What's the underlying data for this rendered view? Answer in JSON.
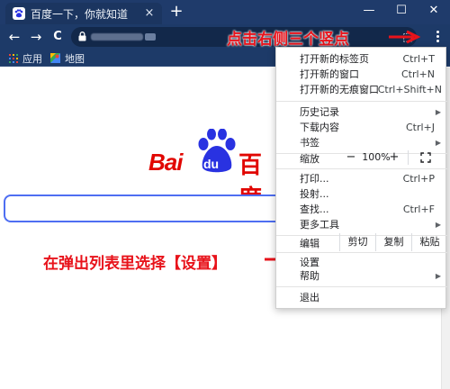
{
  "tab": {
    "title": "百度一下，你就知道",
    "close": "×",
    "new_tab": "+"
  },
  "window": {
    "minimize": "—",
    "maximize": "☐",
    "close": "✕"
  },
  "toolbar": {
    "back": "←",
    "forward": "→",
    "reload": "C",
    "icons": [
      "back-arrow-icon",
      "forward-arrow-icon",
      "reload-icon",
      "lock-icon",
      "extension-icon",
      "kebab-menu-icon"
    ]
  },
  "bookmarks": [
    {
      "label": "应用",
      "icon": "apps-grid-icon"
    },
    {
      "label": "地图",
      "icon": "maps-icon"
    }
  ],
  "logo": {
    "latin": "Bai",
    "paw_text": "du",
    "cn": "百度"
  },
  "annotations": {
    "top": "点击右侧三个竖点",
    "middle": "在弹出列表里选择【设置】"
  },
  "menu": {
    "new_tab": {
      "label": "打开新的标签页",
      "shortcut": "Ctrl+T"
    },
    "new_window": {
      "label": "打开新的窗口",
      "shortcut": "Ctrl+N"
    },
    "incognito": {
      "label": "打开新的无痕窗口",
      "shortcut": "Ctrl+Shift+N"
    },
    "history": {
      "label": "历史记录"
    },
    "downloads": {
      "label": "下载内容",
      "shortcut": "Ctrl+J"
    },
    "bookmarks": {
      "label": "书签"
    },
    "zoom": {
      "label": "缩放",
      "minus": "−",
      "value": "100%",
      "plus": "+"
    },
    "print": {
      "label": "打印...",
      "shortcut": "Ctrl+P"
    },
    "cast": {
      "label": "投射..."
    },
    "find": {
      "label": "查找...",
      "shortcut": "Ctrl+F"
    },
    "more_tools": {
      "label": "更多工具"
    },
    "edit": {
      "label": "编辑",
      "cut": "剪切",
      "copy": "复制",
      "paste": "粘贴"
    },
    "settings": {
      "label": "设置"
    },
    "help": {
      "label": "帮助"
    },
    "exit": {
      "label": "退出"
    },
    "submenu_arrow": "▶"
  },
  "colors": {
    "frame": "#1f3b6b",
    "accent_red": "#e8131b",
    "baidu_red": "#e10601",
    "baidu_blue": "#2932e1",
    "search_border": "#4e6ef2"
  }
}
